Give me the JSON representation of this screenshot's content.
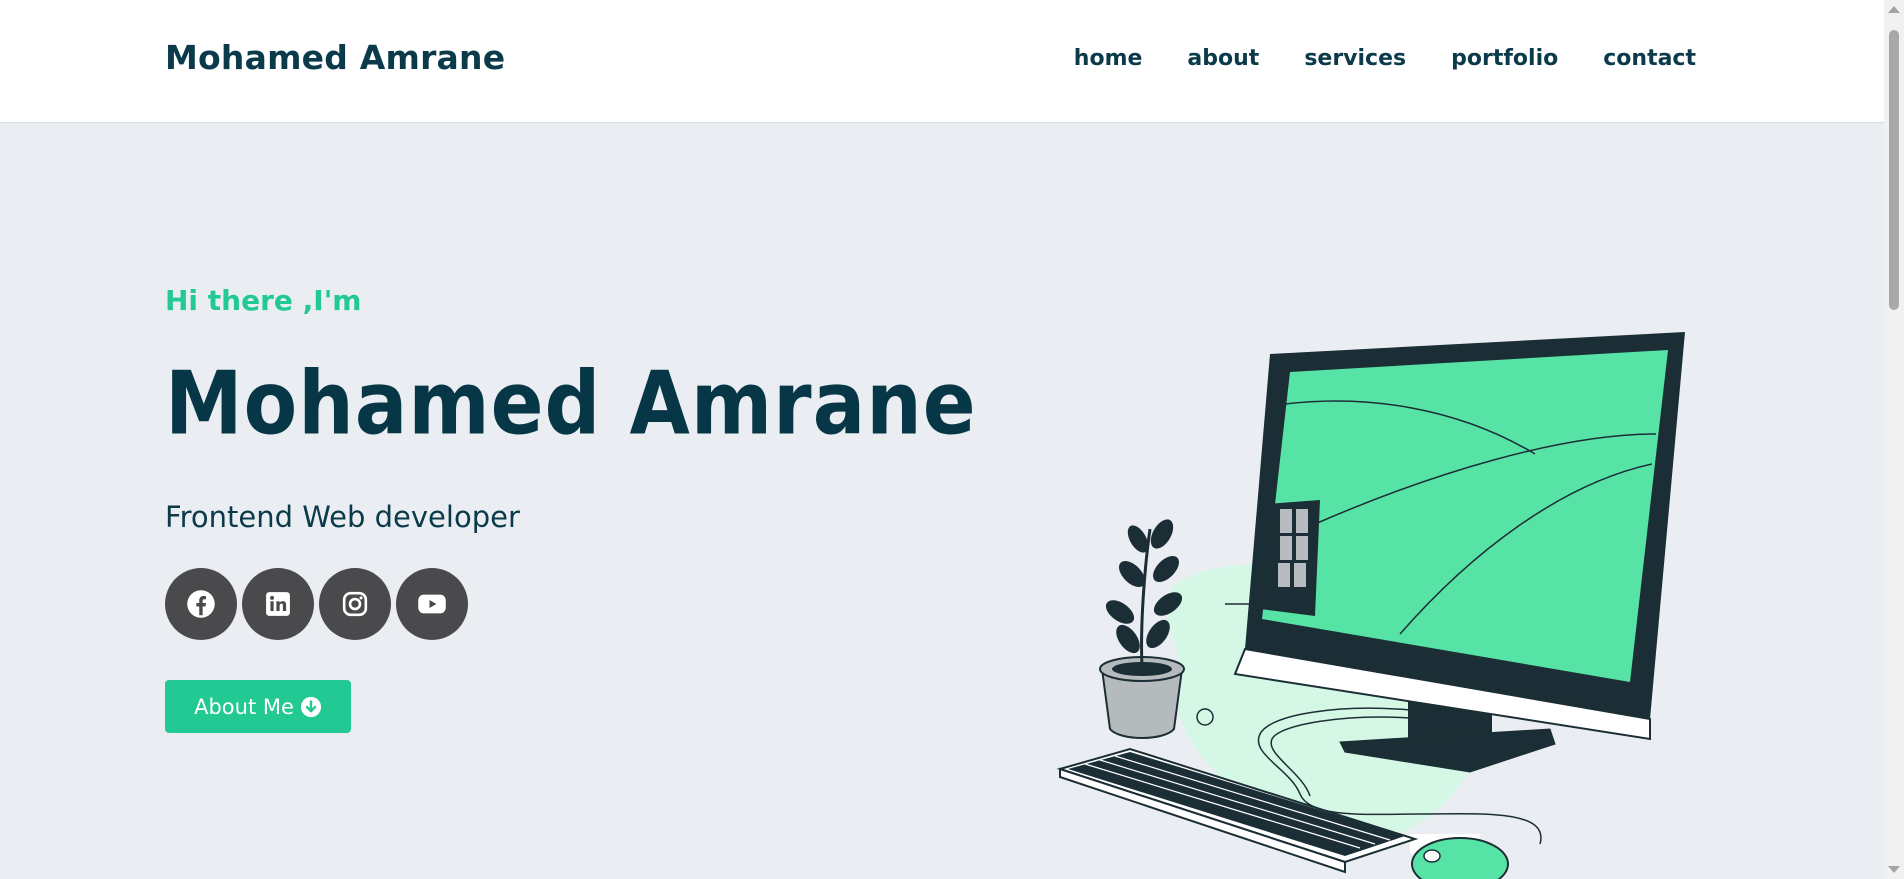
{
  "header": {
    "brand": "Mohamed Amrane",
    "nav": [
      "home",
      "about",
      "services",
      "portfolio",
      "contact"
    ]
  },
  "hero": {
    "greeting": "Hi there ,I'm",
    "name": "Mohamed Amrane",
    "role": "Frontend Web developer",
    "socials": [
      "facebook-icon",
      "linkedin-icon",
      "instagram-icon",
      "youtube-icon"
    ],
    "button_label": "About Me"
  },
  "colors": {
    "accent": "#22c993",
    "primary_text": "#073746",
    "background": "#eaeef2",
    "social_bg": "#4a4a4c"
  }
}
